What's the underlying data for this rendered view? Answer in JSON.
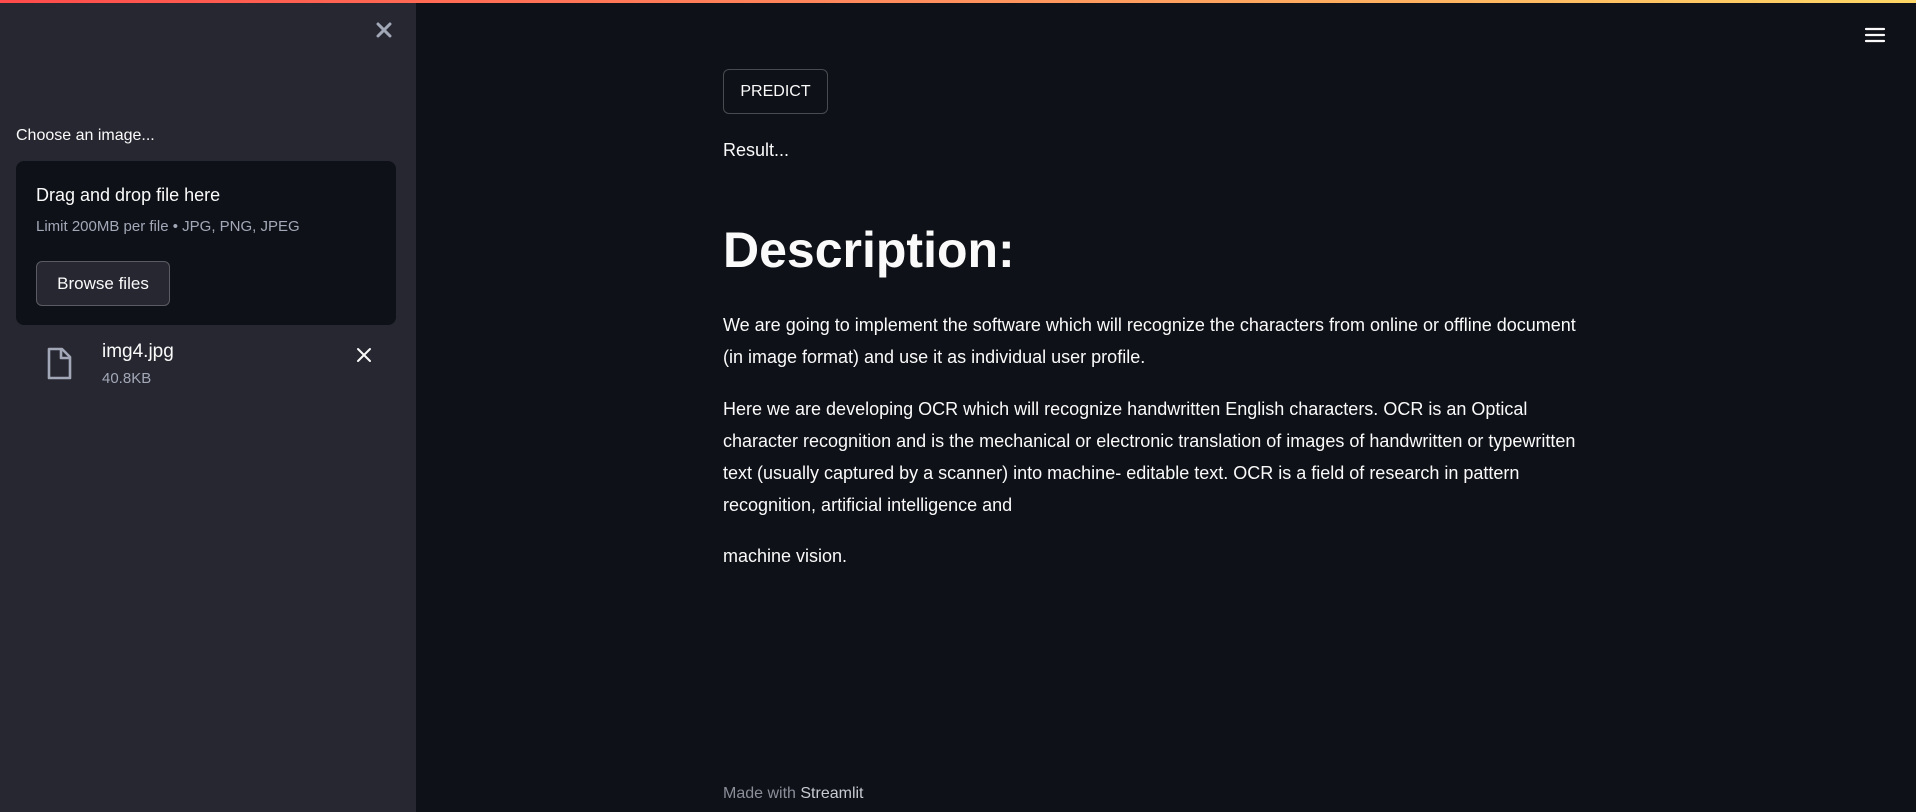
{
  "colors": {
    "sidebar_bg": "#262730",
    "main_bg": "#0e1117",
    "text": "#fafafa",
    "muted_text": "#a3a8b8",
    "accent_gradient": [
      "#ff4b4b",
      "#fdd766"
    ]
  },
  "icons": {
    "sidebar_close": "close-icon",
    "file": "file-icon",
    "file_remove": "close-icon",
    "menu": "hamburger-menu-icon"
  },
  "sidebar": {
    "uploader": {
      "label": "Choose an image...",
      "dropzone_title": "Drag and drop file here",
      "limit_text": "Limit 200MB per file • JPG, PNG, JPEG",
      "browse_label": "Browse files"
    },
    "file": {
      "name": "img4.jpg",
      "size": "40.8KB"
    }
  },
  "main": {
    "predict_label": "PREDICT",
    "result_text": "Result...",
    "heading": "Description:",
    "paragraphs": [
      "We are going to implement the software which will recognize the characters from online or offline document (in image format) and use it as individual user profile.",
      "Here we are developing OCR which will recognize handwritten English characters. OCR is an Optical character recognition and is the mechanical or electronic translation of images of handwritten or typewritten text (usually captured by a scanner) into machine- editable text. OCR is a field of research in pattern recognition, artificial intelligence and",
      "machine vision."
    ]
  },
  "footer": {
    "prefix": "Made with",
    "brand": "Streamlit"
  }
}
